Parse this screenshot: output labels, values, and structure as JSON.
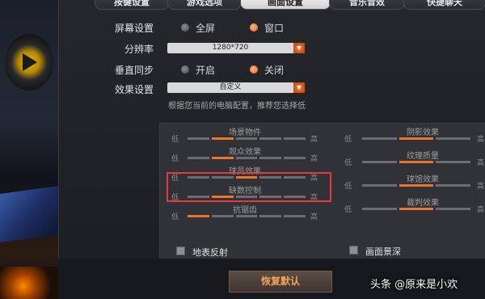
{
  "tabs": [
    {
      "label": "按键设置"
    },
    {
      "label": "游戏选项"
    },
    {
      "label": "画面设置",
      "active": true
    },
    {
      "label": "音乐音效"
    },
    {
      "label": "快捷聊天"
    }
  ],
  "screen_setting": {
    "label": "屏幕设置",
    "options": [
      {
        "label": "全屏",
        "selected": false
      },
      {
        "label": "窗口",
        "selected": true
      }
    ]
  },
  "resolution": {
    "label": "分辨率",
    "value": "1280*720"
  },
  "vsync": {
    "label": "垂直同步",
    "options": [
      {
        "label": "开启",
        "selected": false
      },
      {
        "label": "关闭",
        "selected": true
      }
    ]
  },
  "effect": {
    "label": "效果设置",
    "value": "自定义",
    "hint": "根据您当前的电脑配置，推荐您选择低"
  },
  "sliders": {
    "low_label": "低",
    "high_label": "高",
    "left": [
      {
        "title": "场景物件",
        "level": 1
      },
      {
        "title": "观众效果",
        "level": 1
      },
      {
        "title": "球员效果",
        "level": 2
      },
      {
        "title": "缺数控制",
        "level": 1
      },
      {
        "title": "抗锯齿",
        "level": 0
      }
    ],
    "right": [
      {
        "title": "阴影效果",
        "level": 1
      },
      {
        "title": "纹理质量",
        "level": 1
      },
      {
        "title": "球馆效果",
        "level": 1
      },
      {
        "title": "裁判效果",
        "level": 1
      }
    ]
  },
  "checkboxes": [
    {
      "label": "地表反射",
      "checked": false
    },
    {
      "label": "画面景深",
      "checked": false
    }
  ],
  "reset_button": "恢复默认",
  "watermark": "头条 @原来是小欢",
  "colors": {
    "accent": "#e8742e",
    "highlight": "#e53a3a"
  }
}
